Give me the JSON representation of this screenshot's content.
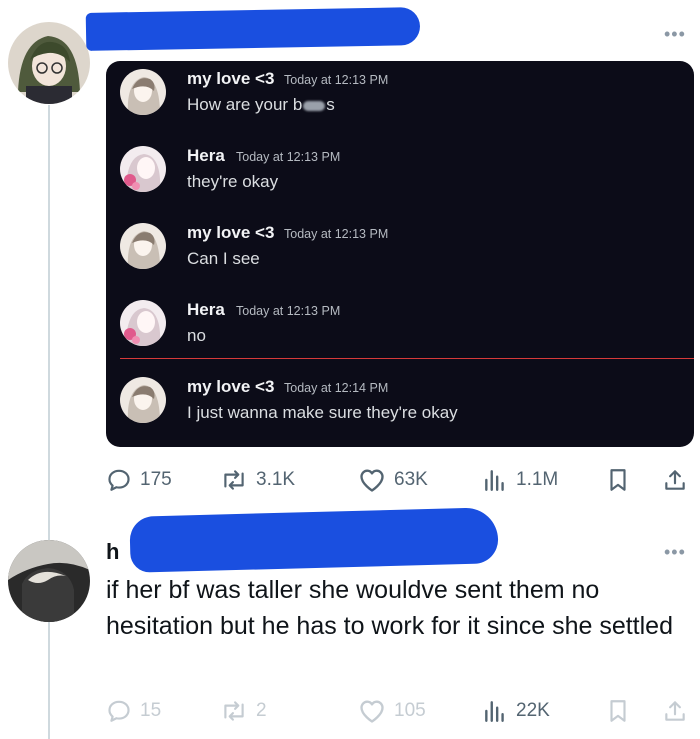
{
  "post": {
    "more_label": "•••",
    "chat": {
      "messages": [
        {
          "author": "my love <3",
          "time": "Today at 12:13 PM",
          "text_before": "How are your b",
          "text_after": "s",
          "redacted": true
        },
        {
          "author": "Hera",
          "time": "Today at 12:13 PM",
          "text": "they're okay"
        },
        {
          "author": "my love <3",
          "time": "Today at 12:13 PM",
          "text": "Can I see"
        },
        {
          "author": "Hera",
          "time": "Today at 12:13 PM",
          "text": "no"
        },
        {
          "author": "my love <3",
          "time": "Today at 12:14 PM",
          "text": "I just wanna make sure they're okay"
        }
      ]
    },
    "stats": {
      "replies": "175",
      "reposts": "3.1K",
      "likes": "63K",
      "views": "1.1M"
    }
  },
  "reply": {
    "handle_initial": "h",
    "more_label": "•••",
    "text": "if her bf was taller she wouldve sent them no hesitation but he has to work for it since she settled",
    "stats": {
      "replies": "15",
      "reposts": "2",
      "likes": "105",
      "views": "22K"
    }
  },
  "colors": {
    "redaction": "#1a4fe0",
    "chat_background": "#0c0c18",
    "new_messages_divider": "#d63a3a",
    "icon_gray": "#536471"
  },
  "icons": [
    "reply-icon",
    "repost-icon",
    "like-icon",
    "views-icon",
    "bookmark-icon",
    "share-icon",
    "more-icon"
  ]
}
